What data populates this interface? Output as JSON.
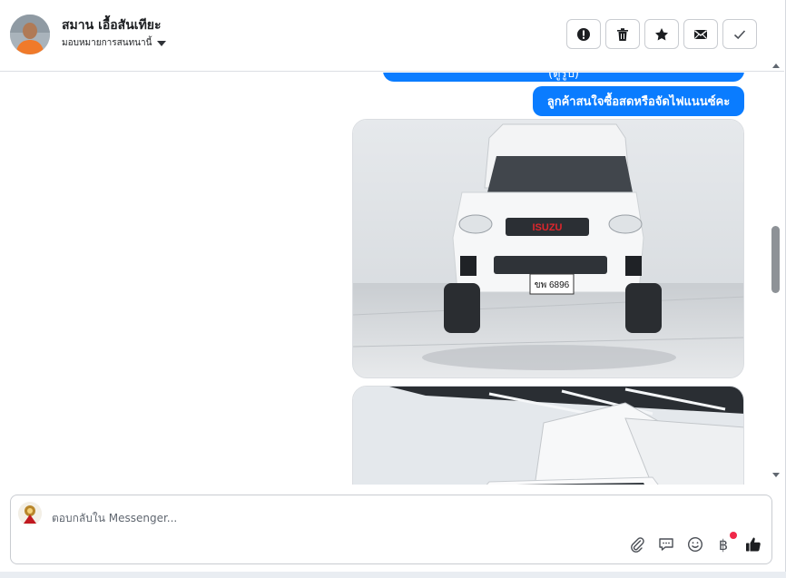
{
  "contact": {
    "name": "สมาน เอื้อสันเทียะ",
    "assign_label": "มอบหมายการสนทนานี้"
  },
  "toolbar": {
    "icons": [
      "alert-icon",
      "trash-icon",
      "star-icon",
      "mail-icon",
      "check-icon"
    ]
  },
  "messages": {
    "top_partial": "(ดูรูป)",
    "last_text": "ลูกค้าสนใจซื้อสดหรือจัดไฟแนนซ์คะ",
    "photo1_plate": "ขพ 6896",
    "photo1_brand": "ISUZU"
  },
  "composer": {
    "placeholder": "ตอบกลับใน Messenger...",
    "baht_symbol": "฿"
  },
  "colors": {
    "accent": "#0a7cff",
    "notification_dot": "#f02849",
    "border": "#c9ccd1"
  }
}
